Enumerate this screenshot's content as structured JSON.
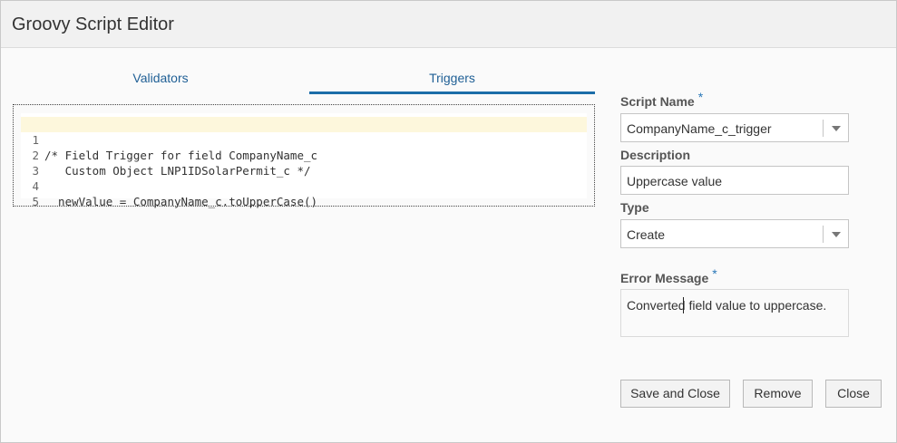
{
  "header": {
    "title": "Groovy Script Editor"
  },
  "tabs": [
    {
      "label": "Validators",
      "active": false
    },
    {
      "label": "Triggers",
      "active": true
    }
  ],
  "editor": {
    "lines": [
      {
        "number": "1",
        "text": "/* Field Trigger for field CompanyName_c"
      },
      {
        "number": "2",
        "text": "   Custom Object LNP1IDSolarPermit_c */"
      },
      {
        "number": "3",
        "text": ""
      },
      {
        "number": "4",
        "text": "  newValue = CompanyName_c.toUpperCase()"
      },
      {
        "number": "5",
        "text": ""
      }
    ]
  },
  "form": {
    "script_name": {
      "label": "Script Name",
      "required_marker": "*",
      "value": "CompanyName_c_trigger"
    },
    "description": {
      "label": "Description",
      "value": "Uppercase value"
    },
    "type": {
      "label": "Type",
      "value": "Create"
    },
    "error_message": {
      "label": "Error Message",
      "required_marker": "*",
      "value": "Converted field value to uppercase."
    }
  },
  "buttons": {
    "save_close": "Save and Close",
    "remove": "Remove",
    "close": "Close"
  },
  "colors": {
    "accent": "#1c6da8",
    "active_line": "#fdf7dc",
    "required": "#2a78b8"
  }
}
